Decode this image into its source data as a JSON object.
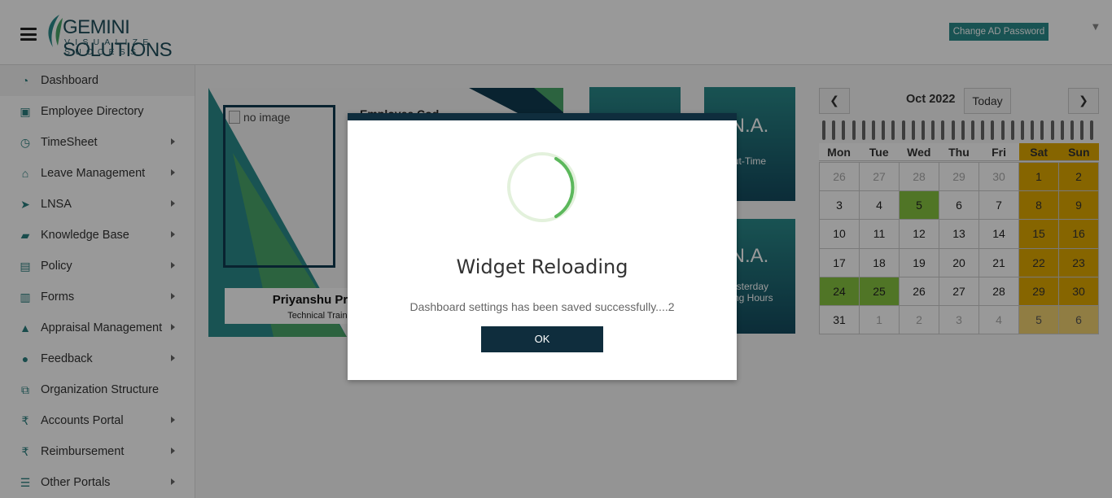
{
  "header": {
    "brand_name": "GEMINI SOLUTIONS",
    "brand_tagline": "VISUALIZE SUCCESS",
    "change_password_label": "Change AD Password"
  },
  "sidebar": {
    "items": [
      {
        "label": "Dashboard",
        "icon": "dashboard-icon",
        "has_submenu": false,
        "active": true
      },
      {
        "label": "Employee Directory",
        "icon": "id-card-icon",
        "has_submenu": false
      },
      {
        "label": "TimeSheet",
        "icon": "clock-icon",
        "has_submenu": true
      },
      {
        "label": "Leave Management",
        "icon": "home-icon",
        "has_submenu": true
      },
      {
        "label": "LNSA",
        "icon": "paper-plane-icon",
        "has_submenu": true
      },
      {
        "label": "Knowledge Base",
        "icon": "folder-open-icon",
        "has_submenu": true
      },
      {
        "label": "Policy",
        "icon": "document-icon",
        "has_submenu": true
      },
      {
        "label": "Forms",
        "icon": "file-icon",
        "has_submenu": true
      },
      {
        "label": "Appraisal Management",
        "icon": "graduation-cap-icon",
        "has_submenu": true
      },
      {
        "label": "Feedback",
        "icon": "comments-icon",
        "has_submenu": true
      },
      {
        "label": "Organization Structure",
        "icon": "sitemap-icon",
        "has_submenu": false
      },
      {
        "label": "Accounts Portal",
        "icon": "rupee-icon",
        "has_submenu": true
      },
      {
        "label": "Reimbursement",
        "icon": "rupee-icon",
        "has_submenu": true
      },
      {
        "label": "Other Portals",
        "icon": "list-icon",
        "has_submenu": true
      }
    ]
  },
  "profile": {
    "photo_alt": "no image",
    "name": "Priyanshu Prajap",
    "designation": "Technical Trainee",
    "employee_code_label": "Employee Cod"
  },
  "tiles": [
    {
      "value": "N.A.",
      "label": "ut-Time"
    },
    {
      "value": "N.A.",
      "label_line1": "esterday",
      "label_line2": "king Hours"
    }
  ],
  "calendar": {
    "title": "Oct 2022",
    "today_label": "Today",
    "prev_icon": "chevron-left-icon",
    "next_icon": "chevron-right-icon",
    "weekdays": [
      "Mon",
      "Tue",
      "Wed",
      "Thu",
      "Fri",
      "Sat",
      "Sun"
    ],
    "days": [
      {
        "d": "26",
        "cls": "other"
      },
      {
        "d": "27",
        "cls": "other"
      },
      {
        "d": "28",
        "cls": "other"
      },
      {
        "d": "29",
        "cls": "other"
      },
      {
        "d": "30",
        "cls": "other"
      },
      {
        "d": "1",
        "cls": "wk"
      },
      {
        "d": "2",
        "cls": "wk"
      },
      {
        "d": "3",
        "cls": ""
      },
      {
        "d": "4",
        "cls": ""
      },
      {
        "d": "5",
        "cls": "green"
      },
      {
        "d": "6",
        "cls": ""
      },
      {
        "d": "7",
        "cls": ""
      },
      {
        "d": "8",
        "cls": "wk"
      },
      {
        "d": "9",
        "cls": "wk"
      },
      {
        "d": "10",
        "cls": ""
      },
      {
        "d": "11",
        "cls": ""
      },
      {
        "d": "12",
        "cls": ""
      },
      {
        "d": "13",
        "cls": ""
      },
      {
        "d": "14",
        "cls": ""
      },
      {
        "d": "15",
        "cls": "wk"
      },
      {
        "d": "16",
        "cls": "wk"
      },
      {
        "d": "17",
        "cls": ""
      },
      {
        "d": "18",
        "cls": ""
      },
      {
        "d": "19",
        "cls": ""
      },
      {
        "d": "20",
        "cls": ""
      },
      {
        "d": "21",
        "cls": ""
      },
      {
        "d": "22",
        "cls": "wk"
      },
      {
        "d": "23",
        "cls": "wk"
      },
      {
        "d": "24",
        "cls": "green"
      },
      {
        "d": "25",
        "cls": "green"
      },
      {
        "d": "26",
        "cls": ""
      },
      {
        "d": "27",
        "cls": ""
      },
      {
        "d": "28",
        "cls": ""
      },
      {
        "d": "29",
        "cls": "wk"
      },
      {
        "d": "30",
        "cls": "wk"
      },
      {
        "d": "31",
        "cls": ""
      },
      {
        "d": "1",
        "cls": "other"
      },
      {
        "d": "2",
        "cls": "other"
      },
      {
        "d": "3",
        "cls": "other"
      },
      {
        "d": "4",
        "cls": "other"
      },
      {
        "d": "5",
        "cls": "wk other"
      },
      {
        "d": "6",
        "cls": "wk other"
      }
    ]
  },
  "modal": {
    "title": "Widget Reloading",
    "message": "Dashboard settings has been saved successfully....2",
    "ok_label": "OK"
  },
  "colors": {
    "accent": "#2a8a8a",
    "dark": "#0f2d3d",
    "weekend": "#e0a800",
    "present": "#86c440"
  }
}
